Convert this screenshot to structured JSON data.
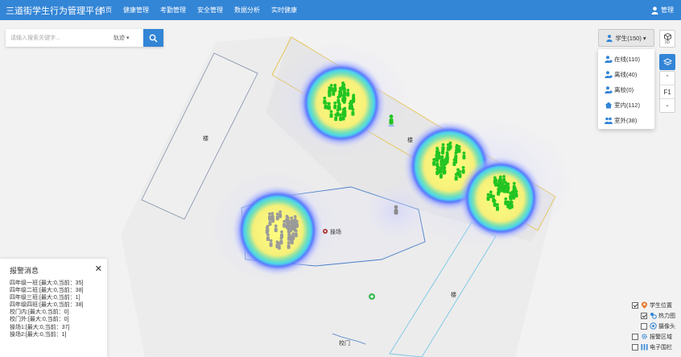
{
  "app": {
    "title": "三道街学生行为管理平台"
  },
  "nav": [
    {
      "label": "首页"
    },
    {
      "label": "健康管理"
    },
    {
      "label": "考勤管理"
    },
    {
      "label": "安全管理"
    },
    {
      "label": "数据分析"
    },
    {
      "label": "实时健康"
    }
  ],
  "user": {
    "label": "管理"
  },
  "search": {
    "placeholder": "请输入搜索关键字...",
    "select_label": "轨迹",
    "button_icon": "search-icon"
  },
  "student_filter": {
    "label": "学生(150)",
    "items": [
      {
        "label": "在线(110)",
        "icon": "user-online-icon"
      },
      {
        "label": "离线(40)",
        "icon": "user-offline-icon"
      },
      {
        "label": "离校(0)",
        "icon": "user-left-icon"
      },
      {
        "label": "室内(112)",
        "icon": "home-icon"
      },
      {
        "label": "室外(38)",
        "icon": "group-icon"
      }
    ]
  },
  "tools": {
    "view_3d": "3D",
    "floor": "F1"
  },
  "map_labels": {
    "building_left": "楼",
    "building_right": "楼",
    "building_bottom": "楼",
    "playground": "操场",
    "gate": "校门"
  },
  "alarm": {
    "title": "报警消息",
    "lines": [
      "四年级一班:[最大:0,当前：35]",
      "四年级二班:[最大:0,当前：38]",
      "四年级三班:[最大:0,当前：1]",
      "四年级四班:[最大:0,当前：38]",
      "校门内:[最大:0,当前：0]",
      "校门外:[最大:0,当前：0]",
      "操场1:[最大:0,当前：37]",
      "操场2:[最大:0,当前：1]"
    ]
  },
  "layers": [
    {
      "label": "学生位置",
      "checked": true,
      "icon": "location-pin-icon"
    },
    {
      "label": "热力图",
      "checked": true,
      "icon": "heatmap-icon"
    },
    {
      "label": "摄像头",
      "checked": false,
      "icon": "camera-icon"
    },
    {
      "label": "报警区域",
      "checked": false,
      "icon": "gear-icon"
    },
    {
      "label": "电子围栏",
      "checked": false,
      "icon": "fence-icon"
    }
  ],
  "colors": {
    "primary": "#3385d6",
    "student_online": "#22c422",
    "student_offline": "#9a9a9a",
    "fence_yellow": "#e6c24a",
    "area_blue": "#4a7fc8"
  }
}
